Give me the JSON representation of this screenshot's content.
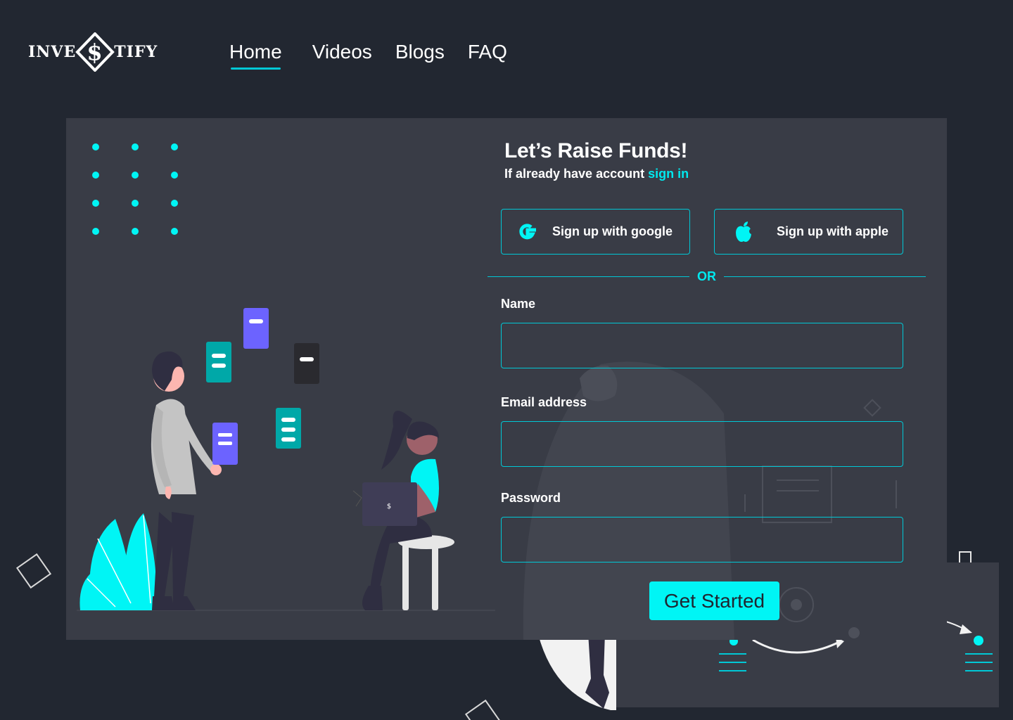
{
  "logo": {
    "left_text": "INVE",
    "right_text": "TIFY",
    "mark_glyph": "$"
  },
  "nav": {
    "items": [
      {
        "label": "Home",
        "active": true
      },
      {
        "label": "Videos",
        "active": false
      },
      {
        "label": "Blogs",
        "active": false
      },
      {
        "label": "FAQ",
        "active": false
      }
    ]
  },
  "form": {
    "title": "Let’s Raise Funds!",
    "subtitle_prefix": "If already have account ",
    "signin_link": "sign in",
    "google_label": "Sign up with google",
    "apple_label": "Sign up with apple",
    "divider_text": "OR",
    "fields": [
      {
        "label": "Name",
        "value": "",
        "placeholder": ""
      },
      {
        "label": "Email address",
        "value": "",
        "placeholder": ""
      },
      {
        "label": "Password",
        "value": "",
        "placeholder": ""
      }
    ],
    "submit_label": "Get Started"
  },
  "icons": {
    "google": "google-icon",
    "apple": "apple-icon",
    "logo": "dollar-diamond-icon"
  },
  "colors": {
    "background": "#222731",
    "card": "#393c46",
    "accent": "#00e8ee",
    "button": "#00f5f5",
    "purple": "#6c63ff",
    "teal": "#00a8a8"
  }
}
